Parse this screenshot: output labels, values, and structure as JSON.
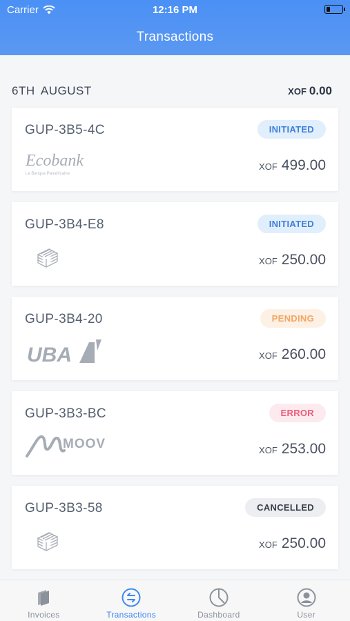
{
  "status_bar": {
    "carrier": "Carrier",
    "time": "12:16 PM"
  },
  "nav": {
    "title": "Transactions"
  },
  "section": {
    "date": "6TH AUGUST",
    "currency": "XOF",
    "total": "0.00"
  },
  "transactions": [
    {
      "id": "GUP-3B5-4C",
      "status": "INITIATED",
      "status_kind": "initiated",
      "currency": "XOF",
      "amount": "499.00",
      "logo": "ecobank",
      "logo_text": "Ecobank",
      "logo_tagline": "La Banque Panafricaine"
    },
    {
      "id": "GUP-3B4-E8",
      "status": "INITIATED",
      "status_kind": "initiated",
      "currency": "XOF",
      "amount": "250.00",
      "logo": "cash-icon"
    },
    {
      "id": "GUP-3B4-20",
      "status": "PENDING",
      "status_kind": "pending",
      "currency": "XOF",
      "amount": "260.00",
      "logo": "uba",
      "logo_text": "UBA"
    },
    {
      "id": "GUP-3B3-BC",
      "status": "ERROR",
      "status_kind": "error",
      "currency": "XOF",
      "amount": "253.00",
      "logo": "moov",
      "logo_text": "MOOV"
    },
    {
      "id": "GUP-3B3-58",
      "status": "CANCELLED",
      "status_kind": "cancelled",
      "currency": "XOF",
      "amount": "250.00",
      "logo": "cash-icon"
    }
  ],
  "tabs": [
    {
      "label": "Invoices",
      "icon": "invoices-icon",
      "active": false
    },
    {
      "label": "Transactions",
      "icon": "transactions-icon",
      "active": true
    },
    {
      "label": "Dashboard",
      "icon": "dashboard-icon",
      "active": false
    },
    {
      "label": "User",
      "icon": "user-icon",
      "active": false
    }
  ],
  "colors": {
    "header": "#4a90f5",
    "accent": "#3d88ef"
  }
}
